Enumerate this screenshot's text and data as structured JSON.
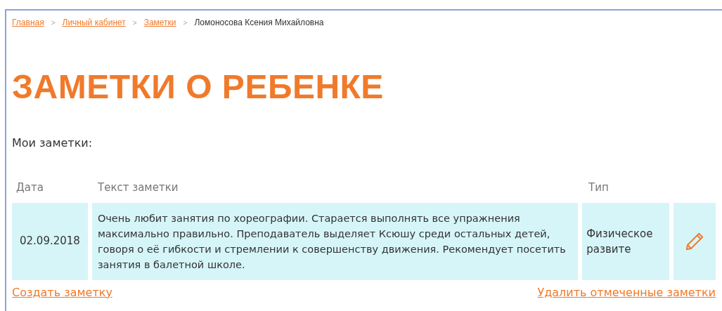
{
  "breadcrumbs": [
    {
      "label": "Главная",
      "link": true
    },
    {
      "label": "Личный кабинет",
      "link": true
    },
    {
      "label": "Заметки",
      "link": true
    },
    {
      "label": "Ломоносова Ксения Михайловна",
      "link": false
    }
  ],
  "breadcrumb_separator": ">",
  "title": "ЗАМЕТКИ О РЕБЕНКЕ",
  "section_label": "Мои заметки:",
  "table": {
    "columns": [
      "Дата",
      "Текст заметки",
      "Тип"
    ],
    "rows": [
      {
        "date": "02.09.2018",
        "text": "Очень любит занятия по хореографии. Старается выполнять все упражнения максимально правильно. Преподаватель выделяет Ксюшу среди остальных детей, говоря о её гибкости и стремлении к совершенству движения. Рекомендует посетить занятия в балетной школе.",
        "type": "Физическое развите"
      }
    ]
  },
  "actions": {
    "create": "Создать заметку",
    "delete": "Удалить отмеченные заметки"
  }
}
